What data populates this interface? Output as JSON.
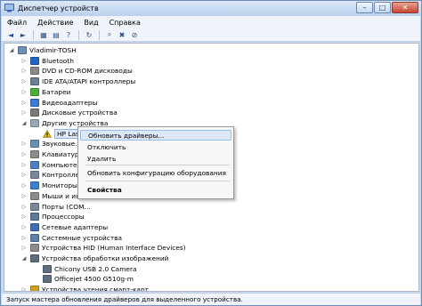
{
  "window": {
    "title": "Диспетчер устройств",
    "minimize": "–",
    "maximize": "□",
    "close": "✕"
  },
  "menu": [
    "Файл",
    "Действие",
    "Вид",
    "Справка"
  ],
  "toolbar": [
    {
      "name": "back-icon",
      "glyph": "◄"
    },
    {
      "name": "forward-icon",
      "glyph": "►"
    },
    {
      "name": "sep"
    },
    {
      "name": "properties-icon",
      "glyph": "▦"
    },
    {
      "name": "list-icon",
      "glyph": "▤"
    },
    {
      "name": "help-icon",
      "glyph": "?"
    },
    {
      "name": "sep"
    },
    {
      "name": "update-driver-icon",
      "glyph": "↻"
    },
    {
      "name": "sep"
    },
    {
      "name": "scan-hardware-icon",
      "glyph": "⌕"
    },
    {
      "name": "uninstall-icon",
      "glyph": "✖"
    },
    {
      "name": "disable-icon",
      "glyph": "⊘"
    }
  ],
  "tree": [
    {
      "label": "Vladimir-TOSH",
      "indent": 0,
      "exp": "◢",
      "icon": "computer",
      "color": "#6f8fb6"
    },
    {
      "label": "Bluetooth",
      "indent": 1,
      "exp": "▷",
      "icon": "bluetooth",
      "color": "#2463c6"
    },
    {
      "label": "DVD и CD-ROM дисководы",
      "indent": 1,
      "exp": "▷",
      "icon": "dvd",
      "color": "#8a8a8a"
    },
    {
      "label": "IDE ATA/ATAPI контроллеры",
      "indent": 1,
      "exp": "▷",
      "icon": "ide",
      "color": "#6b7f96"
    },
    {
      "label": "Батареи",
      "indent": 1,
      "exp": "▷",
      "icon": "battery",
      "color": "#4fae3a"
    },
    {
      "label": "Видеоадаптеры",
      "indent": 1,
      "exp": "▷",
      "icon": "display-adapter",
      "color": "#3a7bd5"
    },
    {
      "label": "Дисковые устройства",
      "indent": 1,
      "exp": "▷",
      "icon": "disk",
      "color": "#7a7a7a"
    },
    {
      "label": "Другие устройства",
      "indent": 1,
      "exp": "◢",
      "icon": "other-devices",
      "color": "#9aa7b6"
    },
    {
      "label": "HP LaserJet Professional P 1102w",
      "indent": 2,
      "exp": "",
      "icon": "warning",
      "color": "#e1b21a",
      "selected": true
    },
    {
      "label": "Звуковые…",
      "indent": 1,
      "exp": "▷",
      "icon": "sound",
      "color": "#6a8fb0"
    },
    {
      "label": "Клавиатуры",
      "indent": 1,
      "exp": "▷",
      "icon": "keyboard",
      "color": "#8c8c8c"
    },
    {
      "label": "Компьютер",
      "indent": 1,
      "exp": "▷",
      "icon": "computer",
      "color": "#4f7fbf"
    },
    {
      "label": "Контроллеры…",
      "indent": 1,
      "exp": "▷",
      "icon": "controller",
      "color": "#7a8899"
    },
    {
      "label": "Мониторы",
      "indent": 1,
      "exp": "▷",
      "icon": "monitor",
      "color": "#3f7fd0"
    },
    {
      "label": "Мыши и иные…",
      "indent": 1,
      "exp": "▷",
      "icon": "mouse",
      "color": "#8c8c8c"
    },
    {
      "label": "Порты (COM…",
      "indent": 1,
      "exp": "▷",
      "icon": "port",
      "color": "#7a8899"
    },
    {
      "label": "Процессоры",
      "indent": 1,
      "exp": "▷",
      "icon": "cpu",
      "color": "#5a7a9a"
    },
    {
      "label": "Сетевые адаптеры",
      "indent": 1,
      "exp": "▷",
      "icon": "network",
      "color": "#3f6fb0"
    },
    {
      "label": "Системные устройства",
      "indent": 1,
      "exp": "▷",
      "icon": "system",
      "color": "#5f7fa5"
    },
    {
      "label": "Устройства HID (Human Interface Devices)",
      "indent": 1,
      "exp": "▷",
      "icon": "hid",
      "color": "#8c8c8c"
    },
    {
      "label": "Устройства обработки изображений",
      "indent": 1,
      "exp": "◢",
      "icon": "imaging",
      "color": "#5f6f80"
    },
    {
      "label": "Chicony USB 2.0 Camera",
      "indent": 2,
      "exp": "",
      "icon": "camera",
      "color": "#5f6f80"
    },
    {
      "label": "Officejet 4500 G510g-m",
      "indent": 2,
      "exp": "",
      "icon": "scanner",
      "color": "#5f6f80"
    },
    {
      "label": "Устройства чтения смарт-карт",
      "indent": 1,
      "exp": "▷",
      "icon": "smartcard",
      "color": "#c9a227"
    }
  ],
  "context_menu": {
    "items": [
      {
        "label": "Обновить драйверы...",
        "highlighted": true
      },
      {
        "label": "Отключить"
      },
      {
        "label": "Удалить"
      },
      {
        "label": "Обновить конфигурацию оборудования"
      },
      {
        "label": "Свойства",
        "bold": true
      }
    ]
  },
  "status": "Запуск мастера обновления драйверов для выделенного устройства."
}
